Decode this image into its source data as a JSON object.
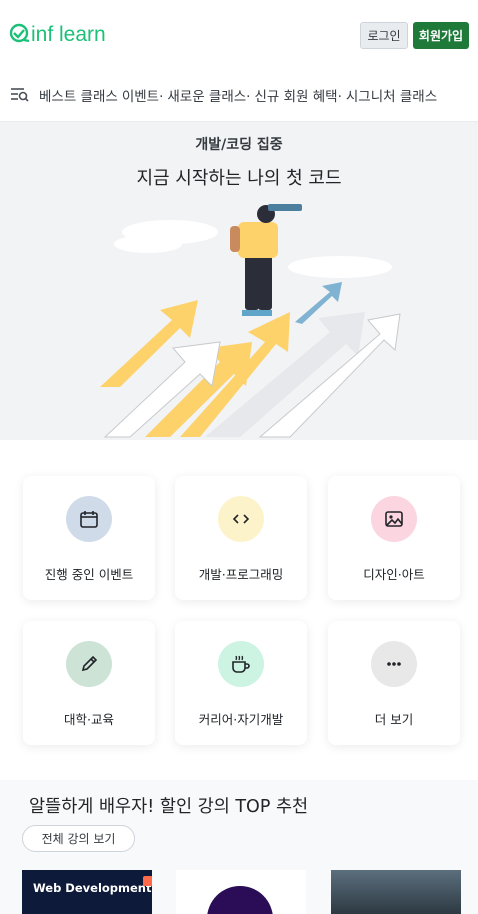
{
  "header": {
    "logo_text": "inflearn",
    "login_label": "로그인",
    "signup_label": "회원가입"
  },
  "nav": {
    "items": [
      "베스트 클래스",
      "이벤트·",
      "새로운 클래스·",
      "신규 회원 혜택·",
      "시그니처 클래스"
    ]
  },
  "hero": {
    "subtitle": "개발/코딩 집중",
    "title": "지금 시작하는 나의 첫 코드"
  },
  "categories": [
    {
      "label": "진행 중인 이벤트",
      "icon": "calendar-icon",
      "color": "#cfdbe8"
    },
    {
      "label": "개발·프로그래밍",
      "icon": "code-icon",
      "color": "#fdf3cb"
    },
    {
      "label": "디자인·아트",
      "icon": "image-icon",
      "color": "#fbd5df"
    },
    {
      "label": "대학·교육",
      "icon": "pencil-icon",
      "color": "#cde3d6"
    },
    {
      "label": "커리어·자기개발",
      "icon": "coffee-icon",
      "color": "#cdf3e3"
    },
    {
      "label": "더 보기",
      "icon": "more-icon",
      "color": "#e8e8e8"
    }
  ],
  "top": {
    "title": "알뜰하게 배우자! 할인 강의 TOP 추천",
    "view_all": "전체 강의 보기",
    "thumb1_title": "Web Development"
  }
}
